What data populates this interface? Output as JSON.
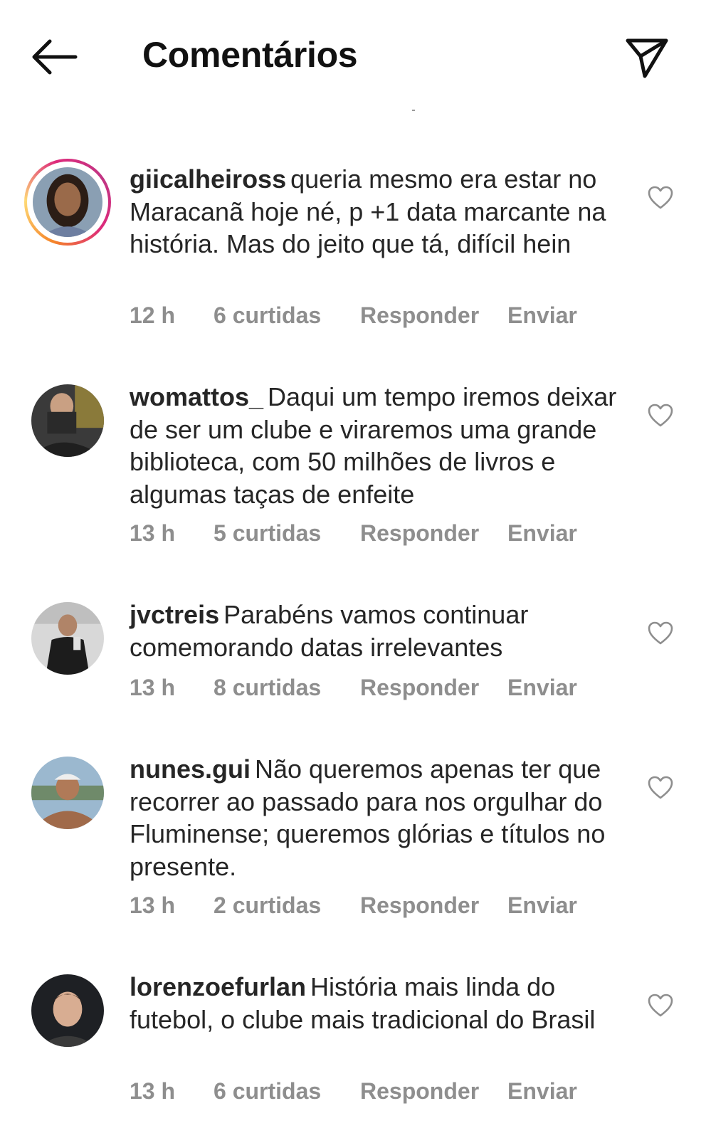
{
  "header": {
    "title": "Comentários",
    "back_icon": "arrow-left-icon",
    "share_icon": "paper-plane-icon"
  },
  "comments": [
    {
      "username": "giicalheiross",
      "text": "queria mesmo era estar no Maracanã hoje né, p +1 data marcante na história. Mas do jeito que tá, difícil hein",
      "time": "12 h",
      "likes": "6 curtidas",
      "reply": "Responder",
      "send": "Enviar",
      "has_story": true
    },
    {
      "username": "womattos_",
      "text": "Daqui um tempo iremos deixar de ser um clube e viraremos uma grande biblioteca, com 50 milhões de livros e algumas taças de enfeite",
      "time": "13 h",
      "likes": "5 curtidas",
      "reply": "Responder",
      "send": "Enviar",
      "has_story": false
    },
    {
      "username": "jvctreis",
      "text": "Parabéns vamos continuar comemorando datas irrelevantes",
      "time": "13 h",
      "likes": "8 curtidas",
      "reply": "Responder",
      "send": "Enviar",
      "has_story": false
    },
    {
      "username": "nunes.gui",
      "text": "Não queremos apenas ter que recorrer ao passado para nos orgulhar do Fluminense; queremos glórias e títulos no presente.",
      "time": "13 h",
      "likes": "2 curtidas",
      "reply": "Responder",
      "send": "Enviar",
      "has_story": false
    },
    {
      "username": "lorenzoefurlan",
      "text": "História mais linda do futebol, o clube mais tradicional do Brasil",
      "time": "13 h",
      "likes": "6 curtidas",
      "reply": "Responder",
      "send": "Enviar",
      "has_story": false
    }
  ],
  "colors": {
    "text": "#262626",
    "meta": "#8e8e8e",
    "story_ring_start": "#f58529",
    "story_ring_end": "#c13584"
  }
}
